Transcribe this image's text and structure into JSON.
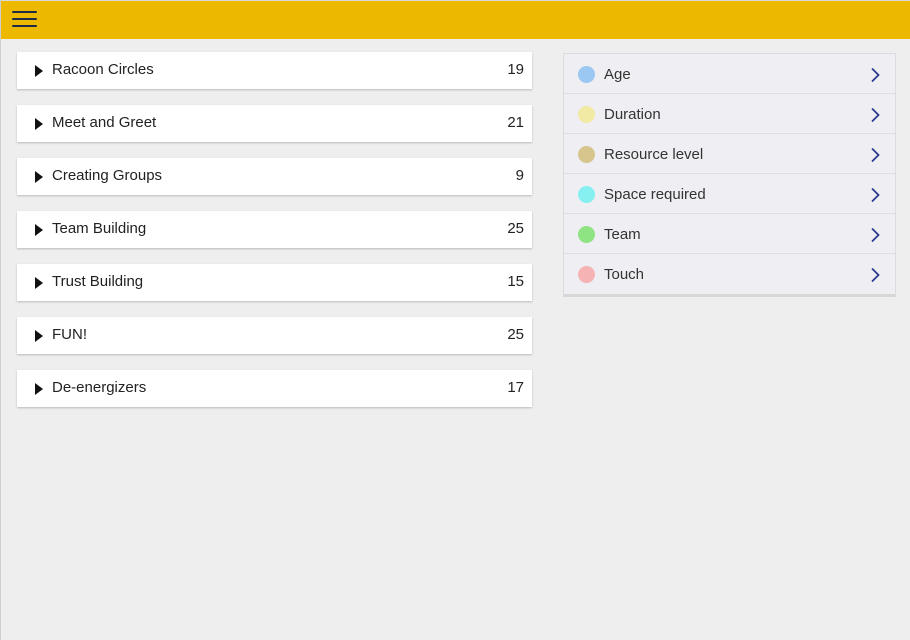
{
  "colors": {
    "topbar": "#edb800",
    "background": "#eeeeee",
    "chevron": "#2b3a8c"
  },
  "header": {
    "menu_icon": "hamburger-menu-icon"
  },
  "categories": [
    {
      "label": "Racoon Circles",
      "count": "19"
    },
    {
      "label": "Meet and Greet",
      "count": "21"
    },
    {
      "label": "Creating Groups",
      "count": "9"
    },
    {
      "label": "Team Building",
      "count": "25"
    },
    {
      "label": "Trust Building",
      "count": "15"
    },
    {
      "label": "FUN!",
      "count": "25"
    },
    {
      "label": "De-energizers",
      "count": "17"
    }
  ],
  "filters": [
    {
      "label": "Age",
      "color": "#9ac8f2"
    },
    {
      "label": "Duration",
      "color": "#f1eaa4"
    },
    {
      "label": "Resource level",
      "color": "#d6c58d"
    },
    {
      "label": "Space required",
      "color": "#86f0f0"
    },
    {
      "label": "Team",
      "color": "#8ee382"
    },
    {
      "label": "Touch",
      "color": "#f6b3b3"
    }
  ]
}
